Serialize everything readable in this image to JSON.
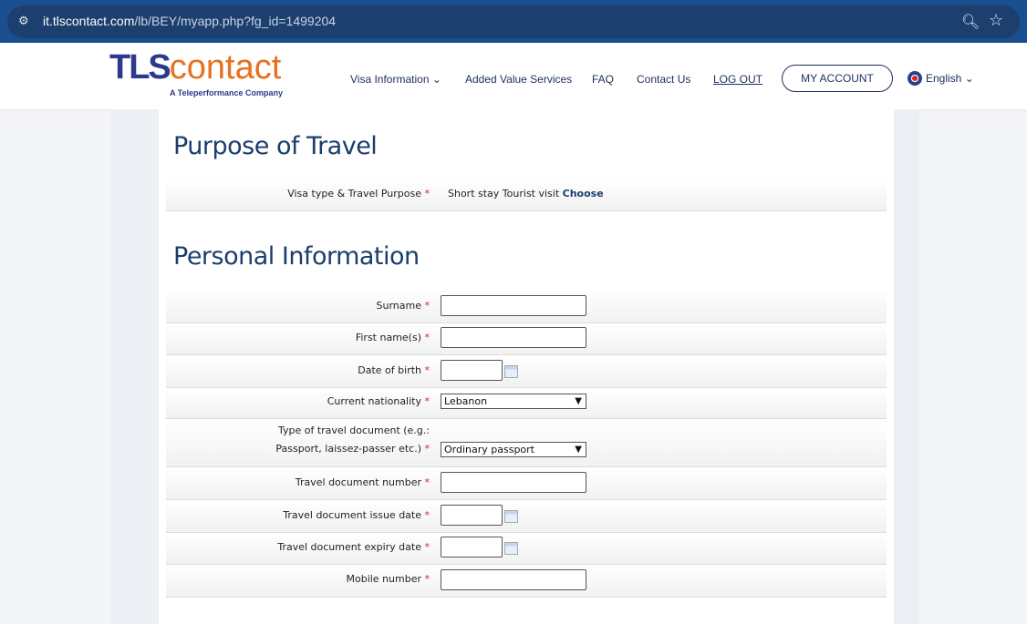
{
  "browser": {
    "url_host": "it.tlscontact.com",
    "url_path": "/lb/BEY/myapp.php?fg_id=1499204"
  },
  "header": {
    "logo_tls": "TLS",
    "logo_contact": "contact",
    "logo_sub": "A Teleperformance Company",
    "nav": [
      "Visa Information",
      "Added Value Services",
      "FAQ",
      "Contact Us",
      "LOG OUT"
    ],
    "account": "MY ACCOUNT",
    "language": "English"
  },
  "purpose": {
    "title": "Purpose of Travel",
    "label": "Visa type & Travel Purpose",
    "value": "Short stay Tourist visit",
    "choose": "Choose"
  },
  "personal": {
    "title": "Personal Information",
    "fields": [
      {
        "label": "Surname",
        "value": ""
      },
      {
        "label": "First name(s)",
        "value": ""
      },
      {
        "label": "Date of birth",
        "value": ""
      },
      {
        "label": "Current nationality",
        "value": "Lebanon"
      },
      {
        "label_line1": "Type of travel document (e.g.:",
        "label_line2": "Passport, laissez-passer etc.)",
        "value": "Ordinary passport"
      },
      {
        "label": "Travel document number",
        "value": ""
      },
      {
        "label": "Travel document issue date",
        "value": ""
      },
      {
        "label": "Travel document expiry date",
        "value": ""
      },
      {
        "label": "Mobile number",
        "value": ""
      }
    ]
  },
  "required_mark": "*"
}
